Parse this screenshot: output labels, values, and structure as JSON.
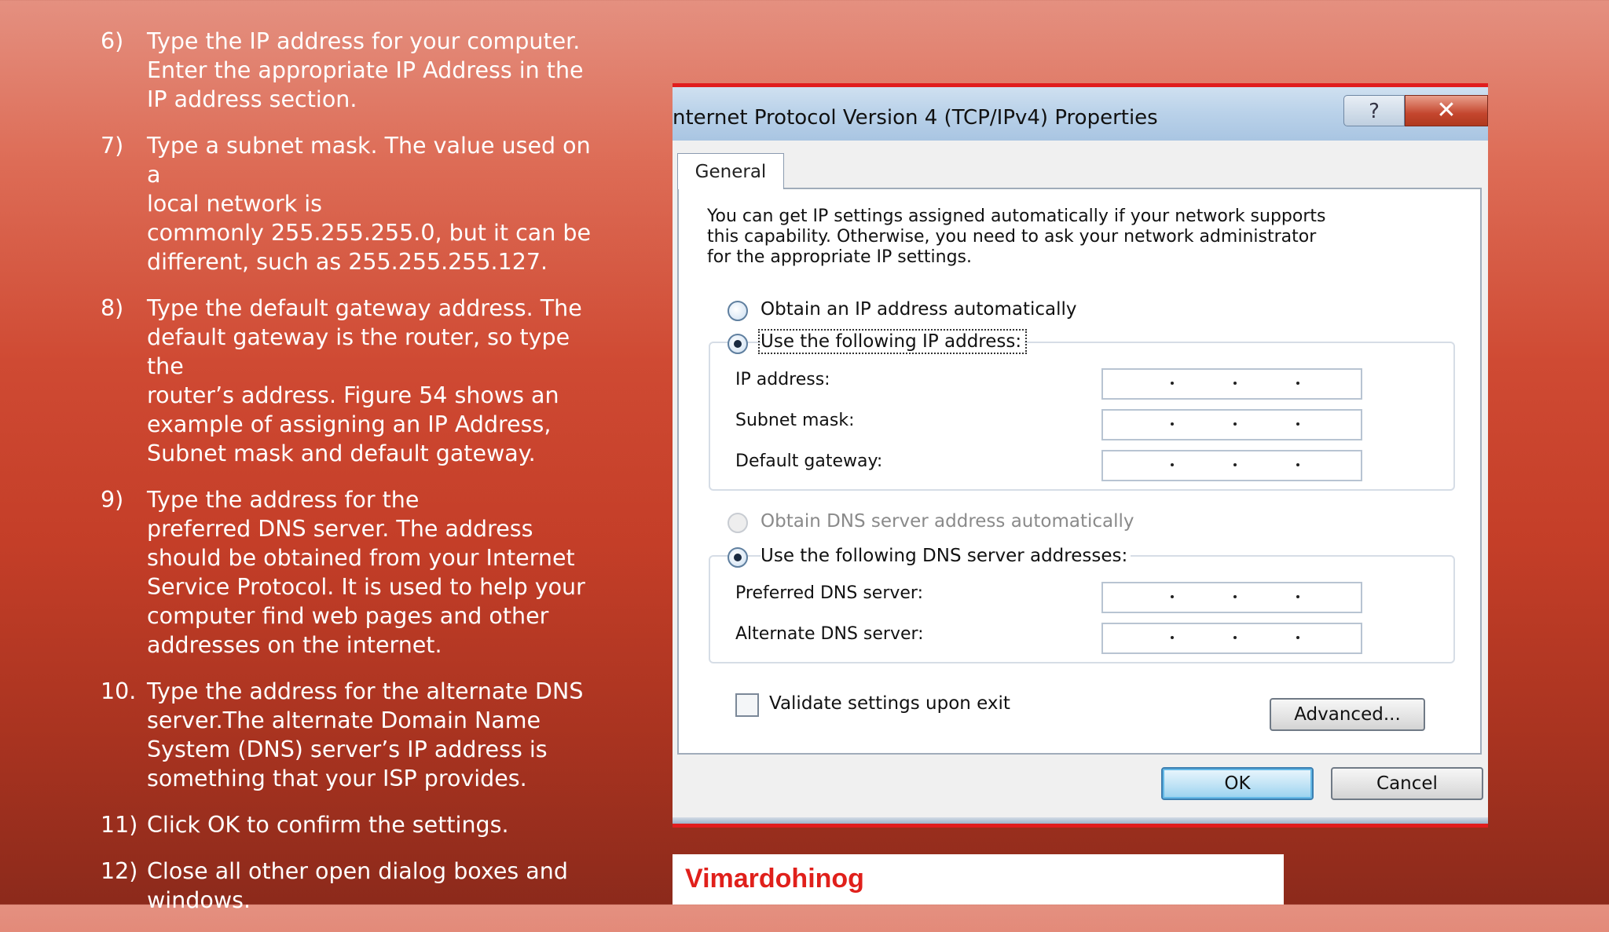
{
  "steps": [
    {
      "num": "6)",
      "lines": [
        "Type the IP address for your computer.",
        "Enter the appropriate IP Address in the",
        "IP address section."
      ]
    },
    {
      "num": "7)",
      "lines": [
        "Type a subnet mask. The value used on a",
        "local network is",
        "commonly 255.255.255.0, but it can be",
        "different, such as 255.255.255.127."
      ]
    },
    {
      "num": "8)",
      "lines": [
        "Type the default gateway address. The",
        "default gateway is the router, so type the",
        "router’s address. Figure 54 shows an",
        "example of assigning an IP Address,",
        "Subnet mask and default gateway."
      ]
    },
    {
      "num": "9)",
      "lines": [
        "Type the address for the",
        "preferred DNS server. The address",
        "should be obtained from your Internet",
        "Service Protocol. It is used to help your",
        "computer find web pages and other",
        "addresses on the internet."
      ]
    },
    {
      "num": "10.",
      "lines": [
        "Type the address for the alternate DNS",
        "server.The alternate Domain Name",
        "System (DNS) server’s IP address is",
        "something that your ISP provides."
      ]
    },
    {
      "num": "11)",
      "lines": [
        "Click OK to confirm the settings."
      ]
    },
    {
      "num": "12)",
      "lines": [
        "Close all other open dialog boxes and",
        "windows."
      ]
    }
  ],
  "dialog": {
    "title": "nternet Protocol Version 4 (TCP/IPv4) Properties",
    "help_glyph": "?",
    "close_glyph": "✕",
    "tab_general": "General",
    "description": [
      "You can get IP settings assigned automatically if your network supports",
      "this capability. Otherwise, you need to ask your network administrator",
      "for the appropriate IP settings."
    ],
    "radio_auto_ip": "Obtain an IP address automatically",
    "radio_manual_ip": "Use the following IP address:",
    "ip_label": "IP address:",
    "subnet_label": "Subnet mask:",
    "gateway_label": "Default gateway:",
    "radio_auto_dns": "Obtain DNS server address automatically",
    "radio_manual_dns": "Use the following DNS server addresses:",
    "preferred_dns_label": "Preferred DNS server:",
    "alternate_dns_label": "Alternate DNS server:",
    "validate_label": "Validate settings upon exit",
    "advanced_button": "Advanced...",
    "ok_button": "OK",
    "cancel_button": "Cancel",
    "selected_ip_mode": "manual",
    "selected_dns_mode": "manual",
    "validate_checked": false
  },
  "footer": {
    "text": "Vimardohinog"
  },
  "colors": {
    "accent_red": "#e11d1d",
    "footer_text": "#e0201b"
  }
}
